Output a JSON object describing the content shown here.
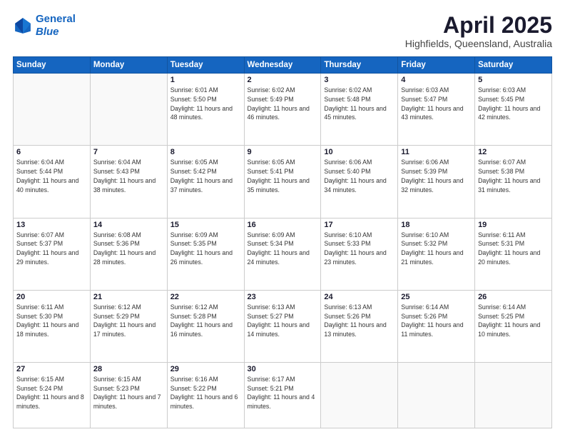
{
  "logo": {
    "line1": "General",
    "line2": "Blue"
  },
  "title": "April 2025",
  "location": "Highfields, Queensland, Australia",
  "days_header": [
    "Sunday",
    "Monday",
    "Tuesday",
    "Wednesday",
    "Thursday",
    "Friday",
    "Saturday"
  ],
  "weeks": [
    [
      {
        "day": "",
        "info": ""
      },
      {
        "day": "",
        "info": ""
      },
      {
        "day": "1",
        "info": "Sunrise: 6:01 AM\nSunset: 5:50 PM\nDaylight: 11 hours and 48 minutes."
      },
      {
        "day": "2",
        "info": "Sunrise: 6:02 AM\nSunset: 5:49 PM\nDaylight: 11 hours and 46 minutes."
      },
      {
        "day": "3",
        "info": "Sunrise: 6:02 AM\nSunset: 5:48 PM\nDaylight: 11 hours and 45 minutes."
      },
      {
        "day": "4",
        "info": "Sunrise: 6:03 AM\nSunset: 5:47 PM\nDaylight: 11 hours and 43 minutes."
      },
      {
        "day": "5",
        "info": "Sunrise: 6:03 AM\nSunset: 5:45 PM\nDaylight: 11 hours and 42 minutes."
      }
    ],
    [
      {
        "day": "6",
        "info": "Sunrise: 6:04 AM\nSunset: 5:44 PM\nDaylight: 11 hours and 40 minutes."
      },
      {
        "day": "7",
        "info": "Sunrise: 6:04 AM\nSunset: 5:43 PM\nDaylight: 11 hours and 38 minutes."
      },
      {
        "day": "8",
        "info": "Sunrise: 6:05 AM\nSunset: 5:42 PM\nDaylight: 11 hours and 37 minutes."
      },
      {
        "day": "9",
        "info": "Sunrise: 6:05 AM\nSunset: 5:41 PM\nDaylight: 11 hours and 35 minutes."
      },
      {
        "day": "10",
        "info": "Sunrise: 6:06 AM\nSunset: 5:40 PM\nDaylight: 11 hours and 34 minutes."
      },
      {
        "day": "11",
        "info": "Sunrise: 6:06 AM\nSunset: 5:39 PM\nDaylight: 11 hours and 32 minutes."
      },
      {
        "day": "12",
        "info": "Sunrise: 6:07 AM\nSunset: 5:38 PM\nDaylight: 11 hours and 31 minutes."
      }
    ],
    [
      {
        "day": "13",
        "info": "Sunrise: 6:07 AM\nSunset: 5:37 PM\nDaylight: 11 hours and 29 minutes."
      },
      {
        "day": "14",
        "info": "Sunrise: 6:08 AM\nSunset: 5:36 PM\nDaylight: 11 hours and 28 minutes."
      },
      {
        "day": "15",
        "info": "Sunrise: 6:09 AM\nSunset: 5:35 PM\nDaylight: 11 hours and 26 minutes."
      },
      {
        "day": "16",
        "info": "Sunrise: 6:09 AM\nSunset: 5:34 PM\nDaylight: 11 hours and 24 minutes."
      },
      {
        "day": "17",
        "info": "Sunrise: 6:10 AM\nSunset: 5:33 PM\nDaylight: 11 hours and 23 minutes."
      },
      {
        "day": "18",
        "info": "Sunrise: 6:10 AM\nSunset: 5:32 PM\nDaylight: 11 hours and 21 minutes."
      },
      {
        "day": "19",
        "info": "Sunrise: 6:11 AM\nSunset: 5:31 PM\nDaylight: 11 hours and 20 minutes."
      }
    ],
    [
      {
        "day": "20",
        "info": "Sunrise: 6:11 AM\nSunset: 5:30 PM\nDaylight: 11 hours and 18 minutes."
      },
      {
        "day": "21",
        "info": "Sunrise: 6:12 AM\nSunset: 5:29 PM\nDaylight: 11 hours and 17 minutes."
      },
      {
        "day": "22",
        "info": "Sunrise: 6:12 AM\nSunset: 5:28 PM\nDaylight: 11 hours and 16 minutes."
      },
      {
        "day": "23",
        "info": "Sunrise: 6:13 AM\nSunset: 5:27 PM\nDaylight: 11 hours and 14 minutes."
      },
      {
        "day": "24",
        "info": "Sunrise: 6:13 AM\nSunset: 5:26 PM\nDaylight: 11 hours and 13 minutes."
      },
      {
        "day": "25",
        "info": "Sunrise: 6:14 AM\nSunset: 5:26 PM\nDaylight: 11 hours and 11 minutes."
      },
      {
        "day": "26",
        "info": "Sunrise: 6:14 AM\nSunset: 5:25 PM\nDaylight: 11 hours and 10 minutes."
      }
    ],
    [
      {
        "day": "27",
        "info": "Sunrise: 6:15 AM\nSunset: 5:24 PM\nDaylight: 11 hours and 8 minutes."
      },
      {
        "day": "28",
        "info": "Sunrise: 6:15 AM\nSunset: 5:23 PM\nDaylight: 11 hours and 7 minutes."
      },
      {
        "day": "29",
        "info": "Sunrise: 6:16 AM\nSunset: 5:22 PM\nDaylight: 11 hours and 6 minutes."
      },
      {
        "day": "30",
        "info": "Sunrise: 6:17 AM\nSunset: 5:21 PM\nDaylight: 11 hours and 4 minutes."
      },
      {
        "day": "",
        "info": ""
      },
      {
        "day": "",
        "info": ""
      },
      {
        "day": "",
        "info": ""
      }
    ]
  ]
}
